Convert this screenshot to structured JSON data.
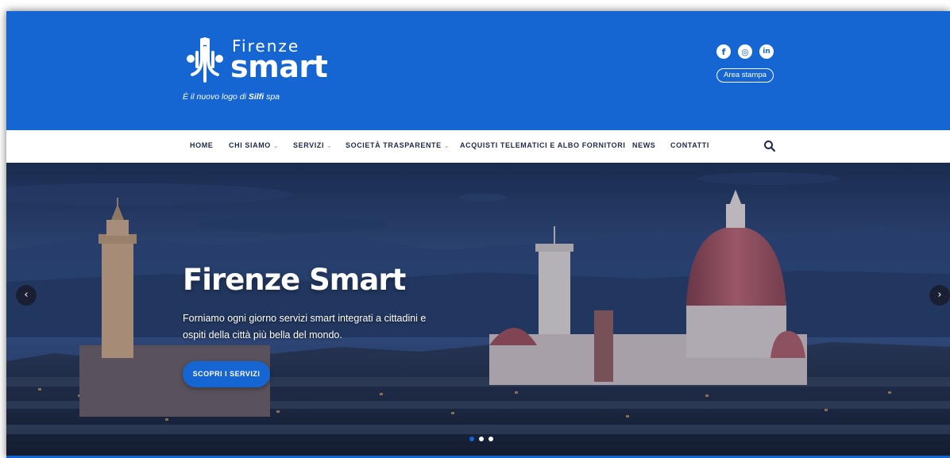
{
  "colors": {
    "brand_blue": "#1565d3",
    "nav_text": "#1e2a47",
    "white": "#ffffff"
  },
  "header": {
    "logo": {
      "icon": "firenze-smart-logo-icon",
      "city": "Firenze",
      "brand": "smart",
      "tagline_prefix": "È il nuovo logo di ",
      "tagline_company": "Silfi",
      "tagline_suffix": " spa"
    },
    "social": [
      {
        "name": "facebook",
        "glyph": "f"
      },
      {
        "name": "instagram",
        "glyph": "◎"
      },
      {
        "name": "linkedin",
        "glyph": "in"
      }
    ],
    "press_area_label": "Area stampa"
  },
  "nav": {
    "items": [
      {
        "label": "HOME",
        "has_dropdown": false
      },
      {
        "label": "CHI SIAMO",
        "has_dropdown": true
      },
      {
        "label": "SERVIZI",
        "has_dropdown": true
      },
      {
        "label": "SOCIETÀ TRASPARENTE",
        "has_dropdown": true
      },
      {
        "label": "ACQUISTI TELEMATICI E ALBO FORNITORI",
        "has_dropdown": false
      },
      {
        "label": "NEWS",
        "has_dropdown": false
      },
      {
        "label": "CONTATTI",
        "has_dropdown": false
      }
    ],
    "caret": "⌄",
    "search_icon": "search-icon"
  },
  "hero": {
    "title": "Firenze Smart",
    "text": "Forniamo ogni giorno servizi smart integrati a cittadini e ospiti della città più bella del mondo.",
    "cta_label": "SCOPRI I SERVIZI",
    "prev_arrow": "‹",
    "next_arrow": "›",
    "slides_count": 3,
    "active_slide": 1
  }
}
